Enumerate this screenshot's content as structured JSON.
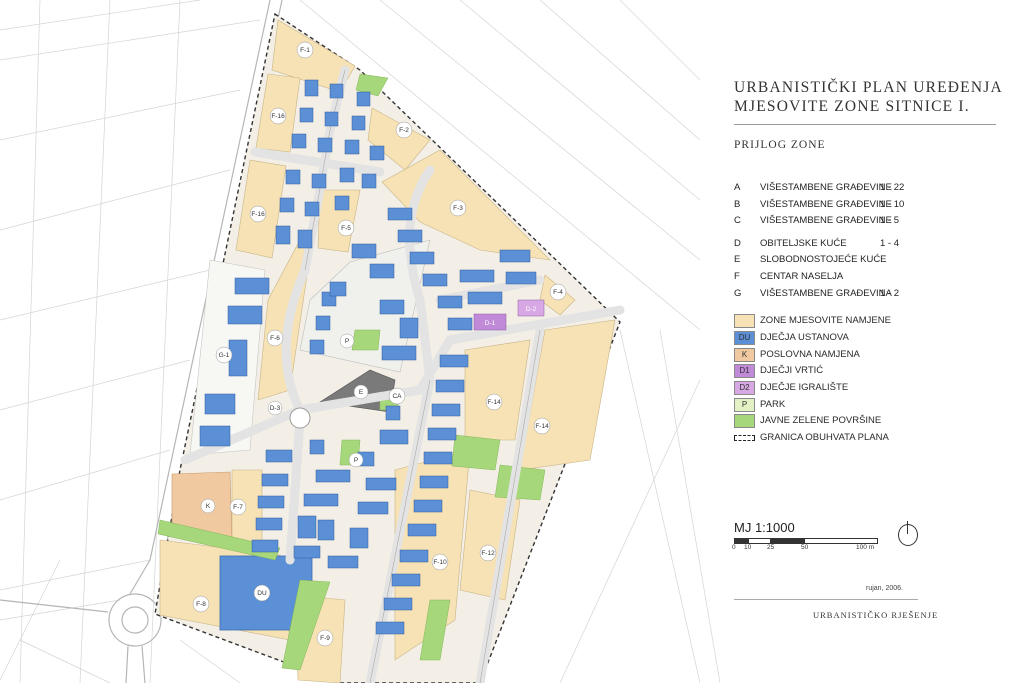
{
  "title": {
    "line1": "URBANISTIČKI PLAN UREĐENJA",
    "line2": "MJESOVITE ZONE SITNICE I."
  },
  "subtitle": "PRIJLOG ZONE",
  "zones": [
    {
      "letter": "A",
      "name": "VIŠESTAMBENE GRAĐEVINE",
      "range": "1 - 22"
    },
    {
      "letter": "B",
      "name": "VIŠESTAMBENE GRAĐEVINE",
      "range": "1 - 10"
    },
    {
      "letter": "C",
      "name": "VIŠESTAMBENE GRAĐEVINE",
      "range": "1 - 5"
    },
    {
      "letter": "D",
      "name": "OBITELJSKE KUĆE",
      "range": "1 - 4"
    },
    {
      "letter": "E",
      "name": "SLOBODNOSTOJEĆE KUĆE",
      "range": ""
    },
    {
      "letter": "F",
      "name": "CENTAR NASELJA",
      "range": ""
    },
    {
      "letter": "G",
      "name": "VIŠESTAMBENE GRAĐEVINA",
      "range": "1 - 2"
    }
  ],
  "legend": [
    {
      "code": "",
      "label": "ZONE MJESOVITE NAMJENE",
      "color": "#f6e2b4"
    },
    {
      "code": "DU",
      "label": "DJEČJA USTANOVA",
      "color": "#5b8fd6"
    },
    {
      "code": "K",
      "label": "POSLOVNA NAMJENA",
      "color": "#f0c9a0"
    },
    {
      "code": "D1",
      "label": "DJEČJI VRTIĆ",
      "color": "#c08ad8"
    },
    {
      "code": "D2",
      "label": "DJEČJE IGRALIŠTE",
      "color": "#d8a8e4"
    },
    {
      "code": "P",
      "label": "PARK",
      "color": "#e2f2c4"
    },
    {
      "code": "",
      "label": "JAVNE ZELENE POVRŠINE",
      "color": "#a6d77a"
    },
    {
      "code": "",
      "label": "GRANICA OBUHVATA PLANA",
      "color": "dashed"
    }
  ],
  "scale": {
    "label": "MJ 1:1000",
    "ticks": [
      "0",
      "10",
      "25",
      "50",
      "100 m"
    ]
  },
  "date": "rujan, 2006.",
  "footer": "URBANISTIČKO RJEŠENJE",
  "map": {
    "zone_labels": [
      "F-1",
      "F-2",
      "F-3",
      "F-4",
      "F-5",
      "F-6",
      "F-7",
      "F-8",
      "F-9",
      "F-10",
      "F-12",
      "F-14",
      "F-14",
      "F-16",
      "F-16",
      "G-1",
      "D-3",
      "D-1",
      "D-2",
      "P",
      "P",
      "E",
      "CA",
      "K",
      "DU"
    ],
    "colors": {
      "zone": "#f6e2b4",
      "park": "#e2f2c4",
      "green": "#a6d77a",
      "building": "#5b8fd6",
      "road": "#e9e9e9",
      "kindergarten": "#c08ad8",
      "business": "#f0c9a0"
    }
  }
}
